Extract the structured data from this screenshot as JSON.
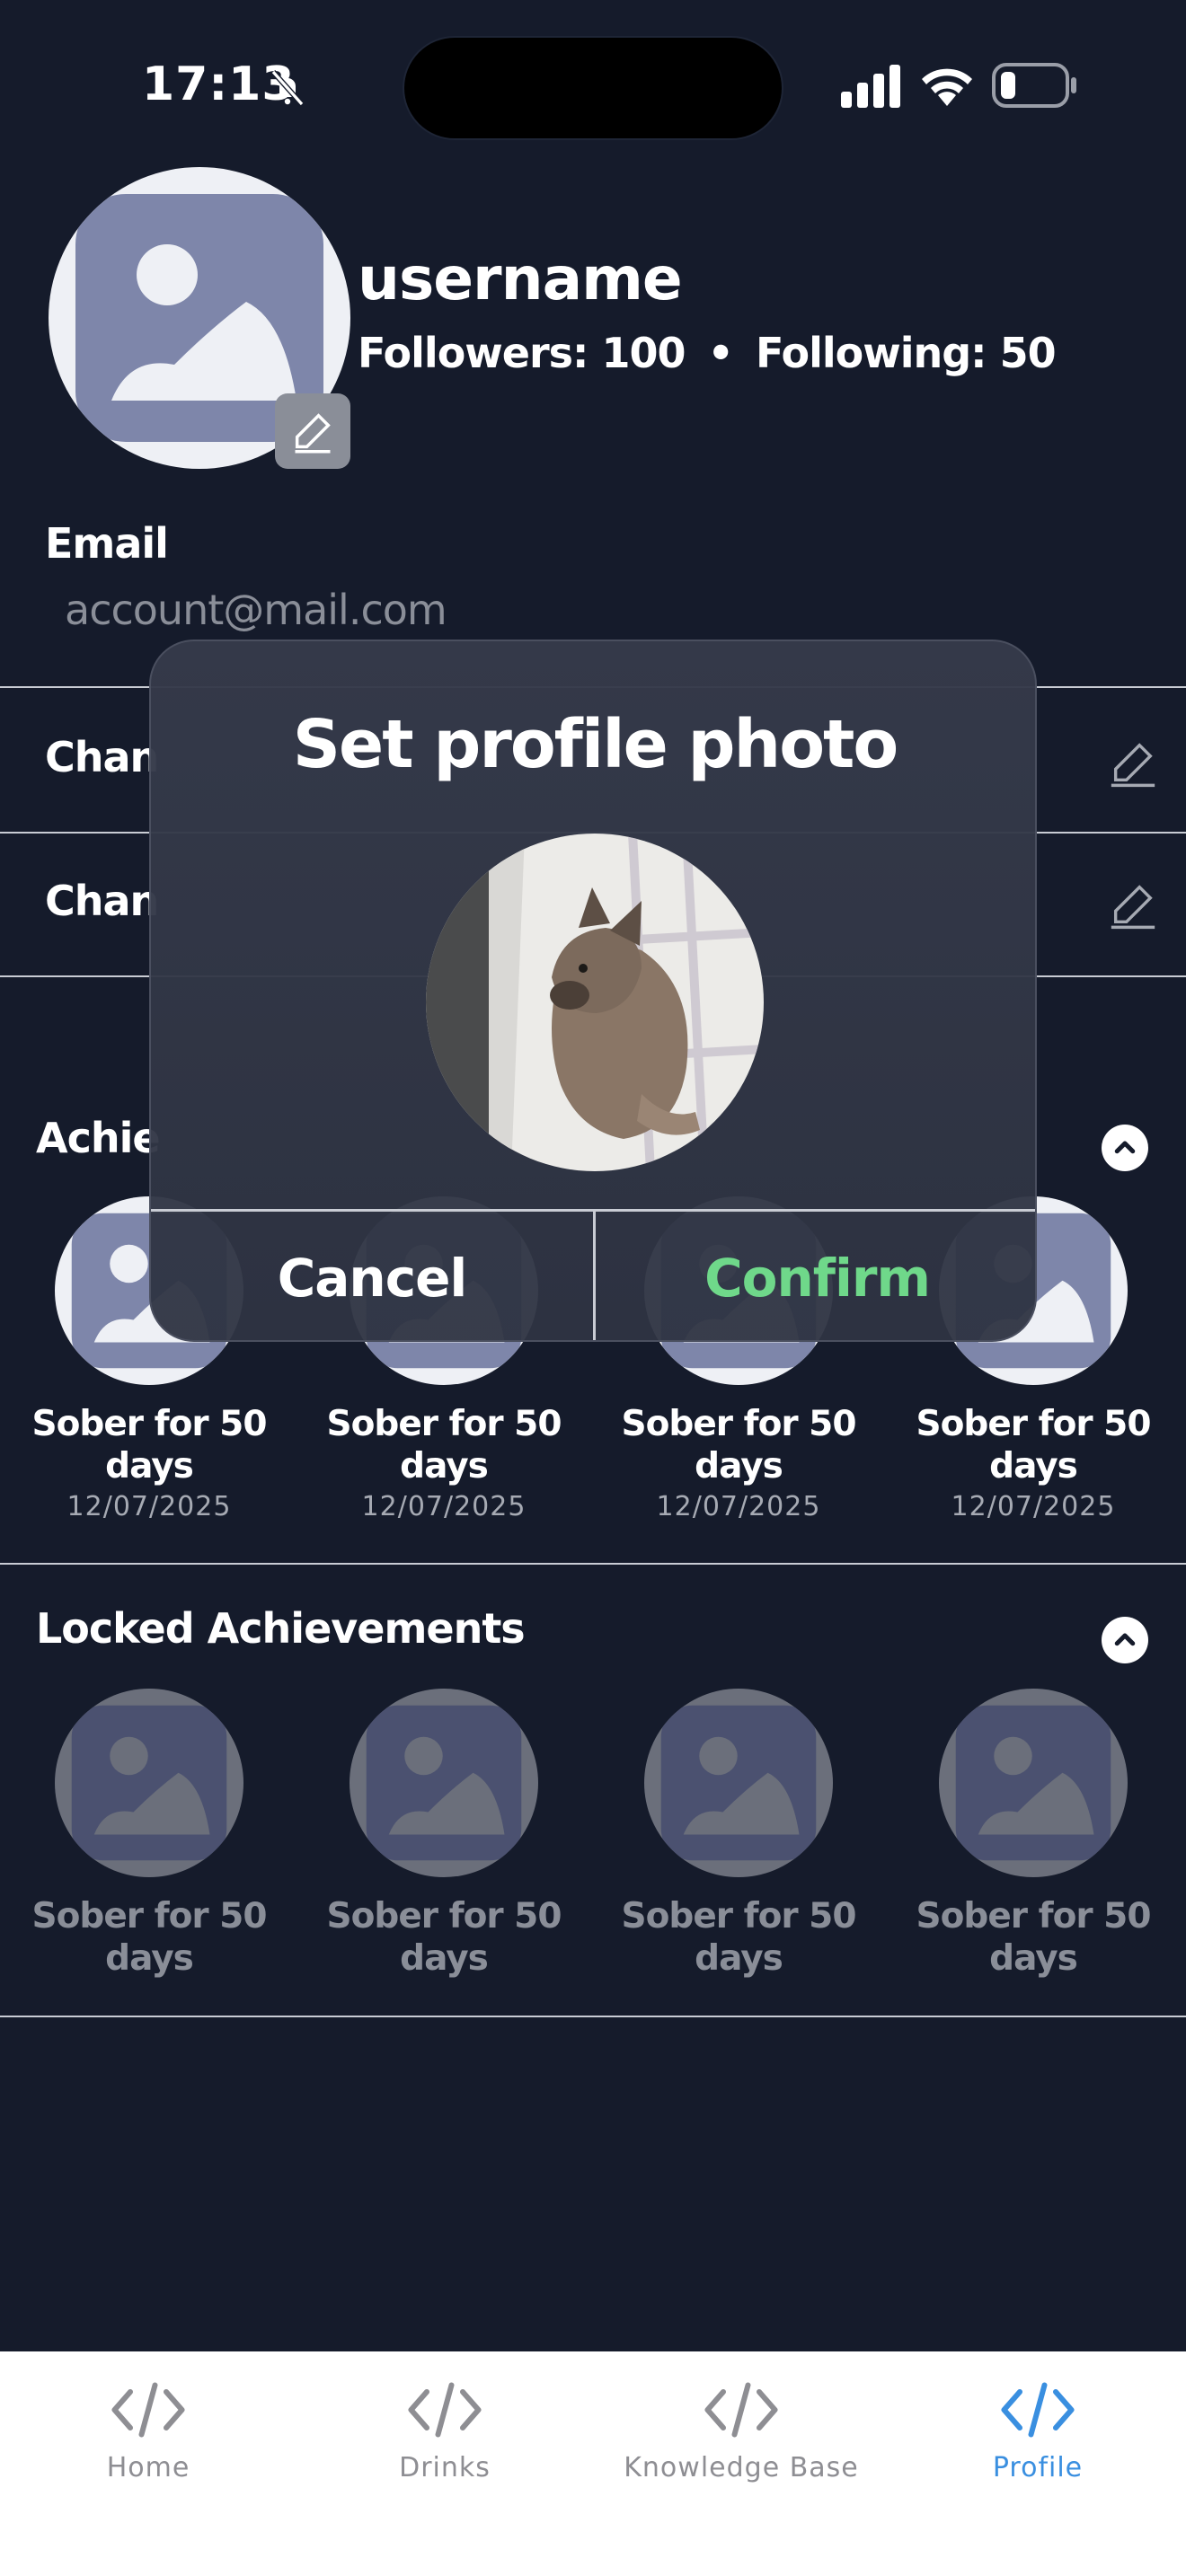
{
  "status_bar": {
    "time": "17:13"
  },
  "profile": {
    "username": "username",
    "followers_text": "Followers: 100",
    "separator": "•",
    "following_text": "Following: 50",
    "email_label": "Email",
    "email_value": "account@mail.com"
  },
  "settings_rows": [
    {
      "label": "Chan"
    },
    {
      "label": "Chan"
    }
  ],
  "achievements": {
    "title": "Achie",
    "items": [
      {
        "title": "Sober for 50 days",
        "date": "12/07/2025"
      },
      {
        "title": "Sober for 50 days",
        "date": "12/07/2025"
      },
      {
        "title": "Sober for 50 days",
        "date": "12/07/2025"
      },
      {
        "title": "Sober for 50 days",
        "date": "12/07/2025"
      }
    ]
  },
  "locked_achievements": {
    "title": "Locked Achievements",
    "items": [
      {
        "title": "Sober for 50 days"
      },
      {
        "title": "Sober for 50 days"
      },
      {
        "title": "Sober for 50 days"
      },
      {
        "title": "Sober for 50 days"
      }
    ]
  },
  "modal": {
    "title": "Set profile photo",
    "cancel_label": "Cancel",
    "confirm_label": "Confirm",
    "confirm_color": "#6fd88a"
  },
  "tabs": [
    {
      "label": "Home",
      "icon": "code-icon",
      "active": false
    },
    {
      "label": "Drinks",
      "icon": "code-icon",
      "active": false
    },
    {
      "label": "Knowledge Base",
      "icon": "code-icon",
      "active": false
    },
    {
      "label": "Profile",
      "icon": "code-icon",
      "active": true
    }
  ],
  "colors": {
    "background": "#151b2b",
    "tab_active": "#3a8fe0",
    "tab_inactive": "#8e8e93"
  }
}
